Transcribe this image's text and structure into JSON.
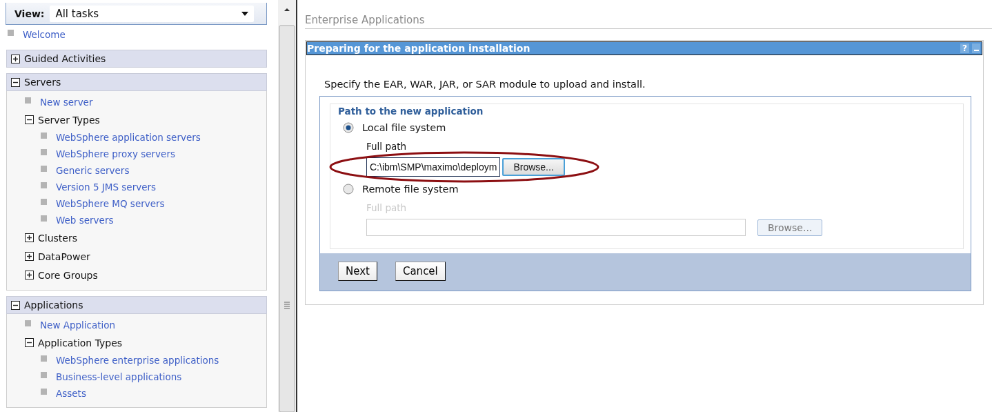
{
  "sidebar": {
    "view": {
      "label": "View:",
      "value": "All tasks"
    },
    "welcome": "Welcome",
    "sections": [
      {
        "title": "Guided Activities",
        "expanded": false
      },
      {
        "title": "Servers",
        "expanded": true,
        "children": [
          {
            "kind": "link",
            "label": "New server"
          },
          {
            "kind": "group",
            "label": "Server Types",
            "expanded": true,
            "children": [
              {
                "kind": "link",
                "label": "WebSphere application servers"
              },
              {
                "kind": "link",
                "label": "WebSphere proxy servers"
              },
              {
                "kind": "link",
                "label": "Generic servers"
              },
              {
                "kind": "link",
                "label": "Version 5 JMS servers"
              },
              {
                "kind": "link",
                "label": "WebSphere MQ servers"
              },
              {
                "kind": "link",
                "label": "Web servers"
              }
            ]
          },
          {
            "kind": "group",
            "label": "Clusters",
            "expanded": false
          },
          {
            "kind": "group",
            "label": "DataPower",
            "expanded": false
          },
          {
            "kind": "group",
            "label": "Core Groups",
            "expanded": false
          }
        ]
      },
      {
        "title": "Applications",
        "expanded": true,
        "children": [
          {
            "kind": "link",
            "label": "New Application"
          },
          {
            "kind": "group",
            "label": "Application Types",
            "expanded": true,
            "children": [
              {
                "kind": "link",
                "label": "WebSphere enterprise applications"
              },
              {
                "kind": "link",
                "label": "Business-level applications"
              },
              {
                "kind": "link",
                "label": "Assets"
              }
            ]
          }
        ]
      }
    ]
  },
  "main": {
    "breadcrumb": "Enterprise Applications",
    "panel": {
      "title": "Preparing for the application installation",
      "help": "?",
      "instruction": "Specify the EAR, WAR, JAR, or SAR module to upload and install.",
      "legend": "Path to the new application",
      "options": [
        {
          "label": "Local file system",
          "selected": true,
          "disabled": false,
          "field": {
            "label": "Full path",
            "value": "C:\\ibm\\SMP\\maximo\\deploym"
          },
          "button": "Browse...",
          "highlighted": true
        },
        {
          "label": "Remote file system",
          "selected": false,
          "disabled": true,
          "field": {
            "label": "Full path"
          },
          "button": "Browse...",
          "highlighted": false
        }
      ],
      "buttons": [
        "Next",
        "Cancel"
      ]
    }
  }
}
